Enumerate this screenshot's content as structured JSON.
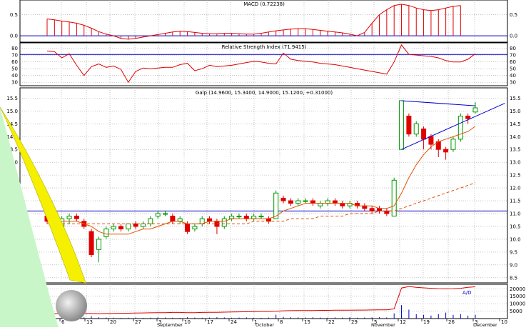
{
  "colors": {
    "background": "#ffffff",
    "frame": "#000000",
    "grid": "#a0a0a0",
    "red": "#e00000",
    "green": "#009a00",
    "blue": "#0000cc",
    "orange": "#e05000",
    "peel_yellow": "#f4f000",
    "peel_green": "#c8f6c8",
    "axis_text": "#000000"
  },
  "chart_data": [
    {
      "type": "bar",
      "panel": "macd",
      "title": "MACD (0.72238)",
      "y_ticks": [
        "0.5",
        "0.0"
      ],
      "ylim": [
        -0.15,
        0.85
      ],
      "series": [
        {
          "values": [
            0.4,
            0.38,
            0.35,
            0.33,
            0.3,
            0.25,
            0.18,
            0.1,
            0.04,
            0.0,
            -0.06,
            -0.08,
            -0.06,
            -0.03,
            0.0,
            0.03,
            0.06,
            0.09,
            0.11,
            0.1,
            0.08,
            0.06,
            0.05,
            0.05,
            0.06,
            0.06,
            0.05,
            0.04,
            0.04,
            0.06,
            0.09,
            0.12,
            0.14,
            0.16,
            0.17,
            0.17,
            0.15,
            0.13,
            0.11,
            0.09,
            0.07,
            0.04,
            0.0,
            0.08,
            0.3,
            0.5,
            0.62,
            0.72,
            0.75,
            0.72,
            0.66,
            0.62,
            0.6,
            0.62,
            0.66,
            0.7,
            0.72
          ]
        }
      ]
    },
    {
      "type": "line",
      "panel": "rsi",
      "title": "Relative Strength Index (71.9415)",
      "y_ticks": [
        "80",
        "70",
        "60",
        "50",
        "40",
        "30"
      ],
      "ylim": [
        25,
        88
      ],
      "reference_line": 71,
      "series": [
        {
          "values": [
            76,
            75,
            66,
            72,
            55,
            40,
            53,
            57,
            52,
            54,
            49,
            30,
            46,
            51,
            50,
            51,
            52,
            52,
            56,
            58,
            47,
            50,
            55,
            53,
            54,
            55,
            57,
            59,
            61,
            60,
            58,
            57,
            73,
            64,
            62,
            61,
            60,
            58,
            57,
            56,
            54,
            52,
            50,
            48,
            46,
            44,
            42,
            60,
            85,
            71,
            70,
            69,
            68,
            66,
            62,
            60,
            60,
            64,
            72
          ]
        }
      ]
    },
    {
      "type": "candlestick",
      "panel": "price",
      "title": "Galp (14.9600, 15.3400, 14.9000, 15.1200, +0.31000)",
      "y_ticks": [
        "15.5",
        "15.0",
        "14.5",
        "14.0",
        "13.5",
        "13.0",
        "12.5",
        "12.0",
        "11.5",
        "11.0",
        "10.5",
        "10.0",
        "9.5",
        "9.0",
        "8.5"
      ],
      "ylim": [
        8.3,
        15.9
      ],
      "x_tick_labels": [
        "6",
        "13",
        "20",
        "27",
        "3",
        "10",
        "17",
        "24",
        "1",
        "8",
        "15",
        "22",
        "29",
        "5",
        "12",
        "19",
        "26",
        "3",
        "10"
      ],
      "month_labels": [
        "September",
        "October",
        "November",
        "December"
      ],
      "support_line": 11.1,
      "series": [
        {
          "name": "ohlc",
          "values": [
            [
              10.9,
              11.0,
              10.6,
              10.7
            ],
            [
              10.7,
              10.8,
              10.3,
              10.4
            ],
            [
              10.5,
              10.9,
              10.4,
              10.8
            ],
            [
              10.8,
              11.0,
              10.6,
              10.9
            ],
            [
              10.9,
              11.0,
              10.7,
              10.8
            ],
            [
              10.7,
              10.8,
              10.4,
              10.5
            ],
            [
              10.3,
              10.4,
              9.3,
              9.4
            ],
            [
              9.6,
              10.1,
              9.1,
              10.0
            ],
            [
              10.1,
              10.5,
              10.0,
              10.4
            ],
            [
              10.4,
              10.6,
              10.3,
              10.5
            ],
            [
              10.5,
              10.6,
              10.3,
              10.4
            ],
            [
              10.4,
              10.6,
              10.3,
              10.6
            ],
            [
              10.6,
              10.7,
              10.4,
              10.5
            ],
            [
              10.5,
              10.7,
              10.4,
              10.6
            ],
            [
              10.6,
              10.9,
              10.5,
              10.8
            ],
            [
              10.9,
              11.1,
              10.8,
              11.0
            ],
            [
              11.0,
              11.1,
              10.9,
              11.0
            ],
            [
              10.9,
              11.0,
              10.6,
              10.7
            ],
            [
              10.7,
              10.9,
              10.6,
              10.8
            ],
            [
              10.6,
              10.7,
              10.2,
              10.3
            ],
            [
              10.4,
              10.6,
              10.3,
              10.5
            ],
            [
              10.6,
              10.9,
              10.5,
              10.8
            ],
            [
              10.8,
              10.9,
              10.6,
              10.7
            ],
            [
              10.7,
              10.8,
              10.2,
              10.5
            ],
            [
              10.5,
              10.9,
              10.4,
              10.8
            ],
            [
              10.8,
              11.0,
              10.7,
              10.9
            ],
            [
              10.9,
              11.0,
              10.8,
              10.9
            ],
            [
              10.9,
              11.0,
              10.7,
              10.8
            ],
            [
              10.8,
              11.0,
              10.7,
              10.9
            ],
            [
              10.9,
              11.0,
              10.8,
              10.9
            ],
            [
              10.8,
              10.9,
              10.6,
              10.7
            ],
            [
              10.8,
              11.9,
              10.8,
              11.8
            ],
            [
              11.6,
              11.7,
              11.4,
              11.5
            ],
            [
              11.5,
              11.6,
              11.3,
              11.4
            ],
            [
              11.4,
              11.6,
              11.3,
              11.5
            ],
            [
              11.5,
              11.6,
              11.4,
              11.5
            ],
            [
              11.5,
              11.6,
              11.3,
              11.4
            ],
            [
              11.3,
              11.5,
              11.2,
              11.4
            ],
            [
              11.4,
              11.6,
              11.3,
              11.5
            ],
            [
              11.5,
              11.6,
              11.3,
              11.4
            ],
            [
              11.4,
              11.5,
              11.2,
              11.3
            ],
            [
              11.3,
              11.5,
              11.2,
              11.4
            ],
            [
              11.4,
              11.5,
              11.2,
              11.3
            ],
            [
              11.3,
              11.4,
              11.1,
              11.2
            ],
            [
              11.2,
              11.3,
              11.0,
              11.1
            ],
            [
              11.2,
              11.3,
              11.0,
              11.1
            ],
            [
              11.1,
              11.2,
              10.9,
              11.0
            ],
            [
              10.9,
              12.4,
              10.9,
              12.3
            ],
            [
              13.5,
              15.4,
              13.5,
              15.4
            ],
            [
              14.8,
              14.9,
              14.0,
              14.1
            ],
            [
              14.1,
              14.6,
              14.0,
              14.5
            ],
            [
              14.3,
              14.4,
              13.5,
              13.9
            ],
            [
              14.0,
              14.1,
              13.5,
              13.7
            ],
            [
              13.8,
              13.9,
              13.2,
              13.5
            ],
            [
              13.5,
              13.6,
              13.1,
              13.4
            ],
            [
              13.5,
              14.0,
              13.4,
              13.9
            ],
            [
              13.9,
              14.9,
              13.8,
              14.8
            ],
            [
              14.8,
              14.9,
              14.5,
              14.7
            ],
            [
              14.96,
              15.34,
              14.9,
              15.12
            ]
          ]
        },
        {
          "name": "ma_short",
          "values": [
            10.8,
            10.8,
            10.7,
            10.7,
            10.7,
            10.6,
            10.5,
            10.3,
            10.2,
            10.2,
            10.2,
            10.2,
            10.3,
            10.4,
            10.4,
            10.5,
            10.6,
            10.7,
            10.7,
            10.6,
            10.6,
            10.6,
            10.7,
            10.7,
            10.7,
            10.8,
            10.8,
            10.8,
            10.8,
            10.8,
            10.8,
            10.9,
            11.1,
            11.2,
            11.3,
            11.4,
            11.4,
            11.4,
            11.4,
            11.4,
            11.4,
            11.4,
            11.3,
            11.3,
            11.3,
            11.2,
            11.2,
            11.3,
            11.8,
            12.4,
            12.9,
            13.3,
            13.6,
            13.8,
            13.9,
            14.0,
            14.1,
            14.2,
            14.4
          ]
        },
        {
          "name": "ma_long",
          "values": [
            10.6,
            10.6,
            10.6,
            10.6,
            10.6,
            10.6,
            10.6,
            10.6,
            10.6,
            10.6,
            10.6,
            10.6,
            10.6,
            10.6,
            10.6,
            10.6,
            10.6,
            10.6,
            10.6,
            10.6,
            10.6,
            10.6,
            10.6,
            10.6,
            10.6,
            10.6,
            10.6,
            10.6,
            10.7,
            10.7,
            10.7,
            10.7,
            10.7,
            10.8,
            10.8,
            10.8,
            10.8,
            10.9,
            10.9,
            10.9,
            10.9,
            11.0,
            11.0,
            11.0,
            11.0,
            11.1,
            11.1,
            11.1,
            11.2,
            11.3,
            11.4,
            11.5,
            11.6,
            11.7,
            11.8,
            11.9,
            12.0,
            12.1,
            12.2
          ]
        }
      ],
      "trendlines": [
        {
          "from": [
            48,
            15.4
          ],
          "to": [
            58,
            15.2
          ]
        },
        {
          "from": [
            48,
            13.5
          ],
          "to": [
            58,
            14.7
          ],
          "extend_to": [
            62,
            15.3
          ]
        }
      ]
    },
    {
      "type": "line",
      "panel": "ad",
      "title": "A/D",
      "y_ticks": [
        "20000",
        "15000",
        "10000",
        "5000",
        "0"
      ],
      "ylim": [
        0,
        23000
      ],
      "series": [
        {
          "name": "ad_line",
          "values": [
            3200,
            3300,
            3400,
            3400,
            3500,
            3500,
            3400,
            3300,
            3400,
            3500,
            3600,
            3600,
            3700,
            3800,
            3900,
            4000,
            4000,
            4100,
            4100,
            4000,
            4000,
            4100,
            4200,
            4200,
            4300,
            4400,
            4500,
            4600,
            4700,
            4800,
            4800,
            4900,
            5200,
            5300,
            5400,
            5400,
            5400,
            5500,
            5500,
            5600,
            5600,
            5600,
            5700,
            5700,
            5800,
            5900,
            5900,
            6500,
            20500,
            21500,
            21000,
            20600,
            20300,
            20100,
            20000,
            20100,
            20300,
            21000,
            21300
          ]
        },
        {
          "name": "volume",
          "values": [
            600,
            800,
            500,
            700,
            600,
            800,
            1500,
            900,
            700,
            600,
            500,
            600,
            700,
            500,
            600,
            800,
            700,
            600,
            500,
            900,
            700,
            600,
            700,
            900,
            800,
            600,
            700,
            800,
            600,
            500,
            700,
            2600,
            1200,
            900,
            800,
            700,
            900,
            700,
            600,
            800,
            700,
            900,
            600,
            700,
            800,
            900,
            800,
            3500,
            9000,
            6000,
            3000,
            2500,
            2000,
            3000,
            4000,
            2500,
            3000,
            2000,
            2500
          ]
        }
      ]
    }
  ]
}
